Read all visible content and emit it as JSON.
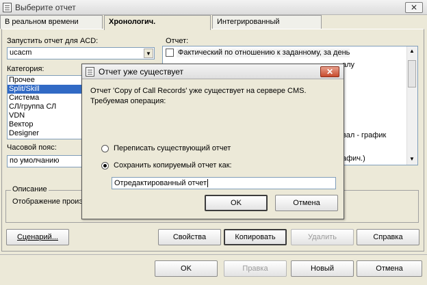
{
  "window": {
    "title": "Выберите отчет",
    "close_glyph": "✕"
  },
  "tabs": [
    {
      "label": "В реальном времени"
    },
    {
      "label": "Хронологич."
    },
    {
      "label": "Интегрированный"
    }
  ],
  "left": {
    "run_for_acd_label": "Запустить отчет для ACD:",
    "acd_value": "ucacm",
    "category_label": "Категория:",
    "categories": [
      "Прочее",
      "Split/Skill",
      "Система",
      "СЛ/группа СЛ",
      "VDN",
      "Вектор",
      "Designer"
    ],
    "selected_category_index": 1,
    "timezone_label": "Часовой пояс:",
    "timezone_value": "по умолчанию"
  },
  "right": {
    "report_label": "Отчет:",
    "reports_visible": [
      "Фактический по отношению к заданному, за день",
      "алу",
      "вал - график",
      "афич.)"
    ]
  },
  "description": {
    "label": "Описание",
    "text": "Отображение проиэ"
  },
  "buttons": {
    "scenario": "Сценарий...",
    "properties": "Свойства",
    "copy": "Копировать",
    "delete": "Удалить",
    "help": "Справка",
    "ok": "OK",
    "edit": "Правка",
    "new": "Новый",
    "cancel": "Отмена"
  },
  "dialog": {
    "title": "Отчет уже существует",
    "message_line1": "Отчет 'Copy of Call Records' уже существует на сервере CMS.",
    "message_line2": "Требуемая операция:",
    "option_overwrite": "Переписать существующий отчет",
    "option_save_as": "Сохранить копируемый отчет как:",
    "selected_option": "save_as",
    "new_name_value": "Отредактированный отчет",
    "ok": "OK",
    "cancel": "Отмена",
    "close_glyph": "✕"
  }
}
